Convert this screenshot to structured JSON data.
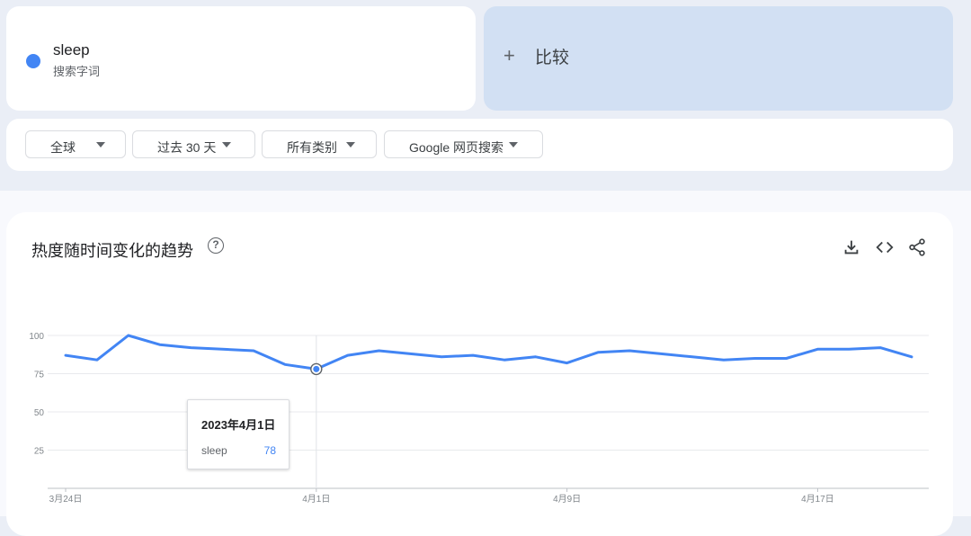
{
  "search_term": {
    "name": "sleep",
    "subtitle": "搜索字词",
    "color": "#4285f4"
  },
  "compare": {
    "label": "比较"
  },
  "filters": [
    {
      "label": "全球"
    },
    {
      "label": "过去 30 天"
    },
    {
      "label": "所有类别"
    },
    {
      "label": "Google 网页搜索"
    }
  ],
  "chart": {
    "title": "热度随时间变化的趋势",
    "tools": [
      "download-icon",
      "embed-code-icon",
      "share-icon"
    ],
    "tooltip": {
      "date": "2023年4月1日",
      "series_name": "sleep",
      "value": "78"
    }
  },
  "chart_data": {
    "type": "line",
    "ylim": [
      0,
      100
    ],
    "yticks": [
      "100",
      "75",
      "50",
      "25"
    ],
    "x": [
      "3月24日",
      "3月25日",
      "3月26日",
      "3月27日",
      "3月28日",
      "3月29日",
      "3月30日",
      "3月31日",
      "4月1日",
      "4月2日",
      "4月3日",
      "4月4日",
      "4月5日",
      "4月6日",
      "4月7日",
      "4月8日",
      "4月9日",
      "4月10日",
      "4月11日",
      "4月12日",
      "4月13日",
      "4月14日",
      "4月15日",
      "4月16日",
      "4月17日",
      "4月18日",
      "4月19日",
      "4月20日"
    ],
    "xtick_labels": [
      "3月24日",
      "4月1日",
      "4月9日",
      "4月17日"
    ],
    "series": [
      {
        "name": "sleep",
        "color": "#4285f4",
        "values": [
          87,
          84,
          100,
          94,
          92,
          91,
          90,
          81,
          78,
          87,
          90,
          88,
          86,
          87,
          84,
          86,
          82,
          89,
          90,
          88,
          86,
          84,
          85,
          85,
          91,
          91,
          92,
          86
        ]
      }
    ],
    "highlight": {
      "x": "4月1日",
      "value": 78
    }
  }
}
